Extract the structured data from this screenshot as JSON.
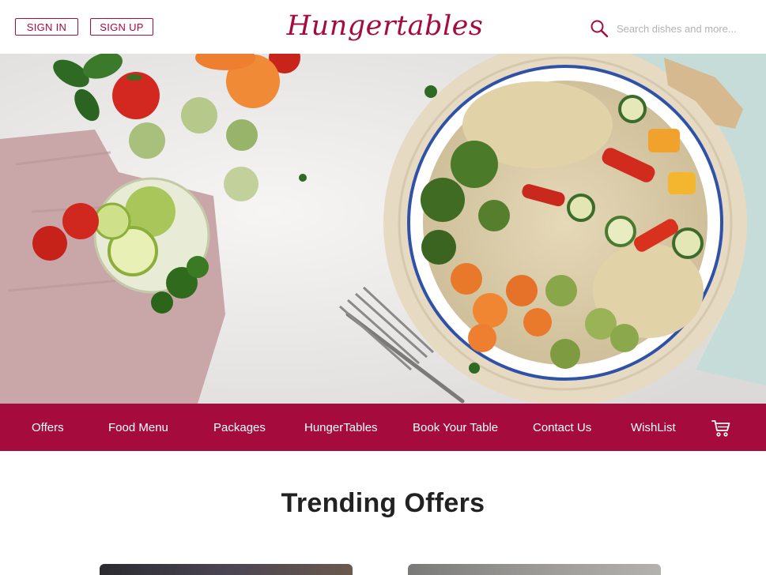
{
  "header": {
    "signin_label": "SIGN IN",
    "signup_label": "SIGN UP",
    "logo_text": "Hungertables",
    "search_placeholder": "Search dishes and more..."
  },
  "hero": {
    "slides_count": 3,
    "active_slide": 3
  },
  "nav": {
    "items": [
      "Offers",
      "Food Menu",
      "Packages",
      "HungerTables",
      "Book Your Table",
      "Contact Us",
      "WishList"
    ],
    "cart_icon": "cart-icon"
  },
  "trending": {
    "title": "Trending Offers"
  },
  "colors": {
    "brand": "#a50b3c",
    "nav_text": "#ffffff",
    "placeholder": "#b3b3b3"
  }
}
